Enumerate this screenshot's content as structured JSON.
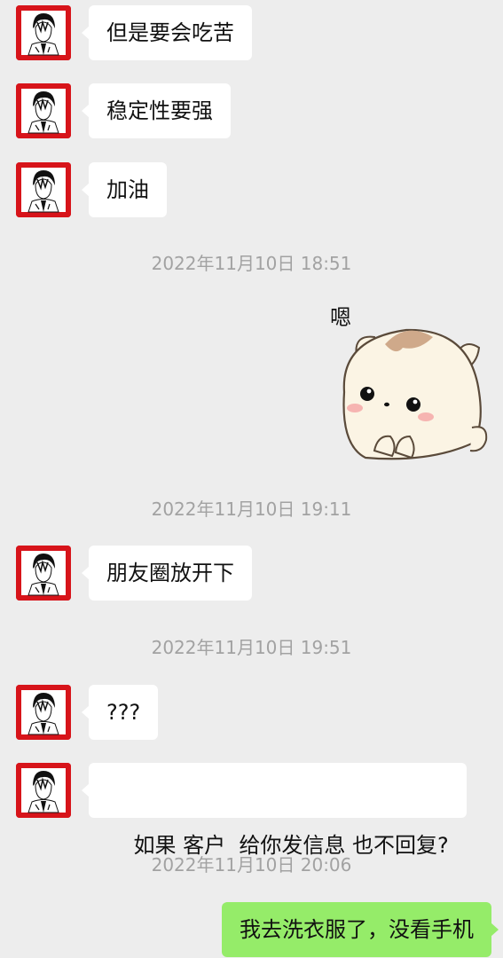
{
  "messages": [
    {
      "type": "received",
      "text": "但是要会吃苦"
    },
    {
      "type": "received",
      "text": "稳定性要强"
    },
    {
      "type": "received",
      "text": "加油"
    },
    {
      "type": "timestamp",
      "text": "2022年11月10日 18:51"
    },
    {
      "type": "sent-sticker",
      "caption": "嗯"
    },
    {
      "type": "timestamp",
      "text": "2022年11月10日 19:11"
    },
    {
      "type": "received",
      "text": "朋友圈放开下"
    },
    {
      "type": "timestamp",
      "text": "2022年11月10日 19:51"
    },
    {
      "type": "received",
      "text": "???"
    },
    {
      "type": "received",
      "text": "如果 客户  给你发信息 也不回复?"
    },
    {
      "type": "timestamp",
      "text": "2022年11月10日 20:06"
    },
    {
      "type": "sent",
      "text": "我去洗衣服了，没看手机"
    }
  ],
  "colors": {
    "background": "#ededed",
    "received_bubble": "#ffffff",
    "sent_bubble": "#95ec69",
    "timestamp_text": "#a2a2a2",
    "avatar_bg": "#d7141a"
  },
  "icons": {
    "contact_avatar": "anime-character-avatar-icon",
    "sticker": "cute-cream-cat-sticker"
  }
}
